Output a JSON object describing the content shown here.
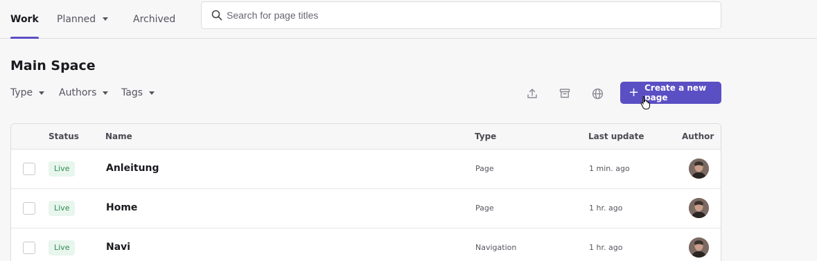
{
  "nav": {
    "tabs": [
      {
        "label": "Work",
        "active": true
      },
      {
        "label": "Planned",
        "dropdown": true
      },
      {
        "label": "Archived"
      }
    ]
  },
  "search": {
    "placeholder": "Search for page titles",
    "value": ""
  },
  "page": {
    "title": "Main Space"
  },
  "filters": [
    {
      "label": "Type"
    },
    {
      "label": "Authors"
    },
    {
      "label": "Tags"
    }
  ],
  "toolbar": {
    "icons": [
      "upload-icon",
      "archive-icon",
      "globe-icon"
    ],
    "create_label": "Create a new page"
  },
  "table": {
    "columns": {
      "status": "Status",
      "name": "Name",
      "type": "Type",
      "last_update": "Last update",
      "author": "Author"
    },
    "rows": [
      {
        "status": "Live",
        "name": "Anleitung",
        "type": "Page",
        "last_update": "1 min. ago"
      },
      {
        "status": "Live",
        "name": "Home",
        "type": "Page",
        "last_update": "1 hr. ago"
      },
      {
        "status": "Live",
        "name": "Navi",
        "type": "Navigation",
        "last_update": "1 hr. ago"
      }
    ]
  },
  "colors": {
    "accent": "#5b4fc4",
    "live_badge_bg": "#e8f6ee",
    "live_badge_text": "#2f8a4e",
    "background": "#f7f7f8"
  }
}
